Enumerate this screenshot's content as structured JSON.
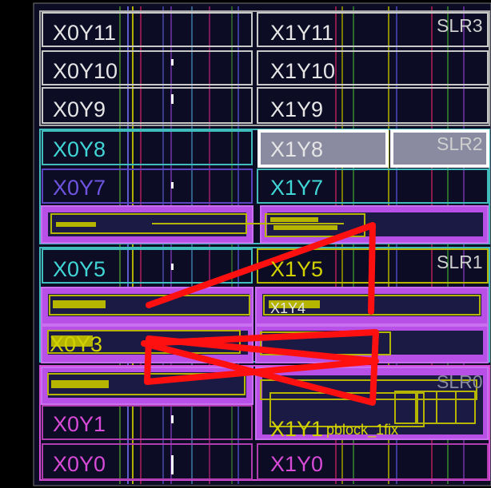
{
  "device_view": {
    "clock_regions": [
      {
        "label": "X0Y11",
        "color": "#e6e6e6"
      },
      {
        "label": "X1Y11",
        "color": "#e6e6e6"
      },
      {
        "label": "X0Y10",
        "color": "#e6e6e6"
      },
      {
        "label": "X1Y10",
        "color": "#e6e6e6"
      },
      {
        "label": "X0Y9",
        "color": "#e6e6e6"
      },
      {
        "label": "X1Y9",
        "color": "#e6e6e6"
      },
      {
        "label": "X0Y8",
        "color": "#41d6d6"
      },
      {
        "label": "X1Y8",
        "color": "#e6e6e6"
      },
      {
        "label": "X0Y7",
        "color": "#6e54e0"
      },
      {
        "label": "X1Y7",
        "color": "#41d6d6"
      },
      {
        "label": "X0Y5",
        "color": "#41d6d6"
      },
      {
        "label": "X1Y5",
        "color": "#d2d200"
      },
      {
        "label": "X1Y4",
        "color": "#e6e6e6"
      },
      {
        "label": "X0Y3",
        "color": "#d2d200"
      },
      {
        "label": "X0Y1",
        "color": "#d84ad8"
      },
      {
        "label": "X1Y1",
        "color": "#d2d200"
      },
      {
        "label": "X0Y0",
        "color": "#d84ad8"
      },
      {
        "label": "X1Y0",
        "color": "#d84ad8"
      }
    ],
    "slrs": [
      {
        "label": "SLR3"
      },
      {
        "label": "SLR2"
      },
      {
        "label": "SLR1"
      },
      {
        "label": "SLR0"
      }
    ],
    "pblock_label": "pblock_1fix",
    "colors": {
      "background": "#000000",
      "fabric": "#0c0c24",
      "pblock_fill": "#b84fe6",
      "pblock_border": "#b5b500",
      "highlight": "#ff1010",
      "selected": "#ffffff"
    }
  }
}
